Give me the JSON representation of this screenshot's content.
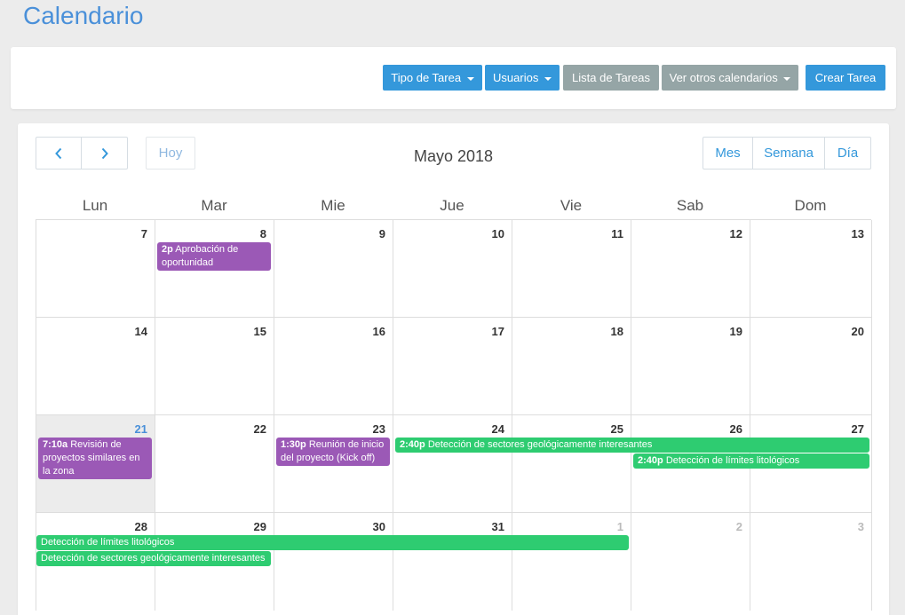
{
  "page": {
    "title": "Calendario"
  },
  "toolbar": {
    "tipo_tarea": "Tipo de Tarea",
    "usuarios": "Usuarios",
    "lista_tareas": "Lista de Tareas",
    "ver_otros": "Ver otros calendarios",
    "crear_tarea": "Crear Tarea"
  },
  "calendar": {
    "today_label": "Hoy",
    "month_title": "Mayo 2018",
    "views": {
      "mes": "Mes",
      "semana": "Semana",
      "dia": "Día"
    },
    "days_of_week": [
      "Lun",
      "Mar",
      "Mie",
      "Jue",
      "Vie",
      "Sab",
      "Dom"
    ],
    "weeks": [
      {
        "days": [
          "7",
          "8",
          "9",
          "10",
          "11",
          "12",
          "13"
        ]
      },
      {
        "days": [
          "14",
          "15",
          "16",
          "17",
          "18",
          "19",
          "20"
        ]
      },
      {
        "days": [
          "21",
          "22",
          "23",
          "24",
          "25",
          "26",
          "27"
        ]
      },
      {
        "days": [
          "28",
          "29",
          "30",
          "31",
          "1",
          "2",
          "3"
        ]
      }
    ],
    "events": {
      "e1": {
        "time": "2p",
        "title": "Aprobación de oportunidad"
      },
      "e2": {
        "time": "7:10a",
        "title": "Revisión de proyectos similares en la zona"
      },
      "e3": {
        "time": "1:30p",
        "title": "Reunión de inicio del proyecto (Kick off)"
      },
      "e4": {
        "time": "2:40p",
        "title": "Detección de sectores geológicamente interesantes"
      },
      "e5": {
        "time": "2:40p",
        "title": "Detección de límites litológicos"
      },
      "e6": {
        "title": "Detección de límites litológicos"
      },
      "e7": {
        "title": "Detección de sectores geológicamente interesantes"
      }
    }
  },
  "colors": {
    "accent": "#3498db",
    "event_purple": "#9b59b6",
    "event_green": "#2ecc71",
    "today_bg": "#ececec"
  },
  "icons": {
    "prev": "chevron-left-icon",
    "next": "chevron-right-icon",
    "dropdown": "caret-down-icon"
  }
}
